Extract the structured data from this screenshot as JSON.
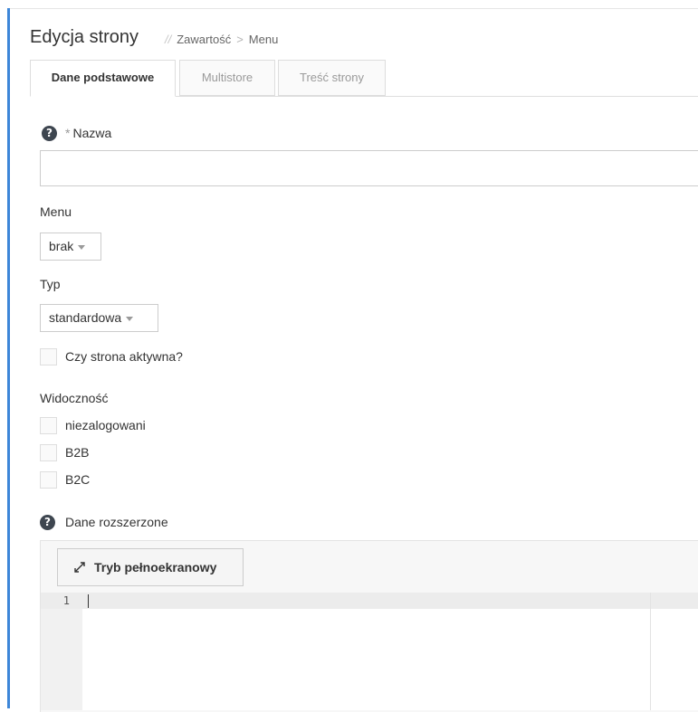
{
  "header": {
    "title": "Edycja strony",
    "breadcrumb_sep": "//",
    "breadcrumb": [
      "Zawartość",
      "Menu"
    ],
    "breadcrumb_arrow": ">"
  },
  "tabs": [
    {
      "label": "Dane podstawowe",
      "active": true
    },
    {
      "label": "Multistore",
      "active": false
    },
    {
      "label": "Treść strony",
      "active": false
    }
  ],
  "form": {
    "name": {
      "required_mark": "*",
      "label": "Nazwa",
      "value": ""
    },
    "menu": {
      "label": "Menu",
      "selected": "brak"
    },
    "type": {
      "label": "Typ",
      "selected": "standardowa"
    },
    "active": {
      "label": "Czy strona aktywna?",
      "checked": false
    },
    "visibility": {
      "label": "Widoczność",
      "options": [
        {
          "label": "niezalogowani",
          "checked": false
        },
        {
          "label": "B2B",
          "checked": false
        },
        {
          "label": "B2C",
          "checked": false
        }
      ]
    },
    "extended": {
      "label": "Dane rozszerzone",
      "fullscreen_button": "Tryb pełnoekranowy",
      "line_number": "1",
      "content": ""
    }
  },
  "icons": {
    "help": "question-circle-icon",
    "fullscreen": "expand-arrows-icon",
    "caret": "caret-down-icon"
  },
  "colors": {
    "accent": "#3d86d8",
    "help_icon": "#3e4650"
  }
}
